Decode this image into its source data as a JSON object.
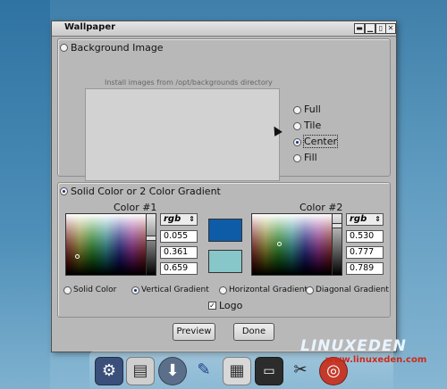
{
  "window": {
    "title": "Wallpaper",
    "buttons": {
      "shade": "▬",
      "minimize": "▁",
      "maximize": "▯",
      "close": "✕"
    }
  },
  "background_image": {
    "label": "Background Image",
    "hint": "Install images from /opt/backgrounds directory",
    "options": [
      {
        "label": "Full",
        "selected": false
      },
      {
        "label": "Tile",
        "selected": false
      },
      {
        "label": "Center",
        "selected": true
      },
      {
        "label": "Fill",
        "selected": false
      }
    ]
  },
  "solid_gradient": {
    "label": "Solid Color or 2 Color Gradient",
    "color1": {
      "heading": "Color #1",
      "mode": "rgb",
      "values": [
        "0.055",
        "0.361",
        "0.659"
      ],
      "swatch": "#0e5ca8"
    },
    "color2": {
      "heading": "Color #2",
      "mode": "rgb",
      "values": [
        "0.530",
        "0.777",
        "0.789"
      ],
      "swatch": "#87c6c9"
    },
    "modes": [
      {
        "label": "Solid Color",
        "selected": false
      },
      {
        "label": "Vertical Gradient",
        "selected": true
      },
      {
        "label": "Horizontal Gradient",
        "selected": false
      },
      {
        "label": "Diagonal Gradient",
        "selected": false
      }
    ],
    "logo": {
      "label": "Logo",
      "checked": true,
      "mark": "✓"
    }
  },
  "actions": {
    "preview": "Preview",
    "done": "Done"
  },
  "dock": {
    "icons": [
      "runner-icon",
      "scanner-icon",
      "download-icon",
      "brush-icon",
      "calculator-icon",
      "terminal-icon",
      "tools-icon",
      "lifesaver-icon"
    ]
  },
  "watermark": {
    "brand": "LINUXEDEN",
    "site": "www.linuxeden.com"
  }
}
